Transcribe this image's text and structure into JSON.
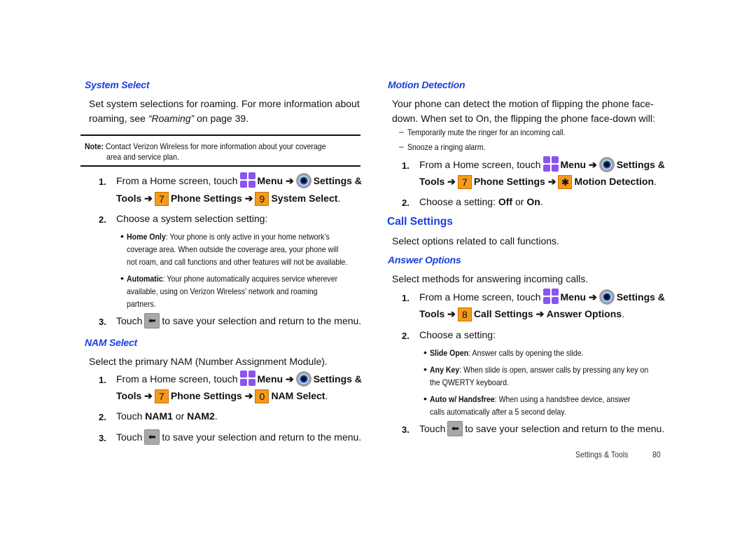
{
  "left": {
    "system_select": {
      "heading": "System Select",
      "intro_1": "Set system selections for roaming. For more information about",
      "intro_2_a": "roaming, see ",
      "intro_2_link": "“Roaming”",
      "intro_2_b": " on page 39.",
      "note_label": "Note:",
      "note_1": " Contact Verizon Wireless for more information about your coverage",
      "note_2": "area and service plan.",
      "step1_num": "1.",
      "step1_a": "From a Home screen, touch",
      "step1_menu": "Menu ➔",
      "step1_settings": "Settings &",
      "step1_tools": "Tools ➔",
      "step1_key1": "7",
      "step1_phone": "Phone Settings ➔",
      "step1_key2": "9",
      "step1_target": "System Select",
      "step1_end": ".",
      "step2_num": "2.",
      "step2": "Choose a system selection setting:",
      "opt1_label": "Home Only",
      "opt1_1": ": Your phone is only active in your home network’s",
      "opt1_2": "coverage area.  When outside the coverage area, your phone will",
      "opt1_3": "not roam, and call functions and other features will not be available.",
      "opt2_label": "Automatic",
      "opt2_1": ": Your phone automatically acquires service wherever",
      "opt2_2": "available, using on Verizon Wireless’ network and roaming",
      "opt2_3": "partners.",
      "step3_num": "3.",
      "step3_a": "Touch",
      "step3_b": "to save your selection and return to the menu."
    },
    "nam_select": {
      "heading": "NAM Select",
      "intro": "Select the primary NAM (Number Assignment Module).",
      "step1_num": "1.",
      "step1_a": "From a Home screen, touch",
      "step1_menu": "Menu ➔",
      "step1_settings": "Settings &",
      "step1_tools": "Tools ➔",
      "step1_key1": "7",
      "step1_phone": "Phone Settings ➔",
      "step1_key2": "0",
      "step1_target": "NAM Select",
      "step1_end": ".",
      "step2_num": "2.",
      "step2_a": "Touch ",
      "step2_nam1": "NAM1",
      "step2_or": " or ",
      "step2_nam2": "NAM2",
      "step2_end": ".",
      "step3_num": "3.",
      "step3_a": "Touch",
      "step3_b": "to save your selection and return to the menu."
    }
  },
  "right": {
    "motion_detection": {
      "heading": "Motion Detection",
      "intro_1": "Your phone can detect the motion of flipping the phone face-",
      "intro_2": "down.  When set to On, the flipping the phone face-down will:",
      "dash1": "Temporarily mute the ringer for an incoming call.",
      "dash2": "Snooze a ringing alarm.",
      "step1_num": "1.",
      "step1_a": "From a Home screen, touch",
      "step1_menu": "Menu ➔",
      "step1_settings": "Settings &",
      "step1_tools": "Tools ➔",
      "step1_key1": "7",
      "step1_phone": "Phone Settings ➔",
      "step1_key2": "✱",
      "step1_target": "Motion Detection",
      "step1_end": ".",
      "step2_num": "2.",
      "step2_a": "Choose a setting: ",
      "step2_off": "Off",
      "step2_or": " or ",
      "step2_on": "On",
      "step2_end": "."
    },
    "call_settings": {
      "heading": "Call Settings",
      "intro": "Select options related to call functions."
    },
    "answer_options": {
      "heading": "Answer Options",
      "intro": "Select methods for answering incoming calls.",
      "step1_num": "1.",
      "step1_a": "From a Home screen, touch",
      "step1_menu": "Menu ➔",
      "step1_settings": "Settings &",
      "step1_tools": "Tools ➔",
      "step1_key1": "8",
      "step1_target": "Call Settings ➔ Answer Options",
      "step1_end": ".",
      "step2_num": "2.",
      "step2": "Choose a setting:",
      "opt1_label": "Slide Open",
      "opt1_1": ": Answer calls by opening the slide.",
      "opt2_label": "Any Key",
      "opt2_1": ": When slide is open, answer calls by pressing any key on",
      "opt2_2": "the QWERTY keyboard.",
      "opt3_label": "Auto w/ Handsfree",
      "opt3_1": ": When using a handsfree device, answer",
      "opt3_2": "calls automatically after a 5 second delay.",
      "step3_num": "3.",
      "step3_a": "Touch",
      "step3_b": "to save your selection and return to the menu."
    }
  },
  "footer": {
    "section": "Settings & Tools",
    "page": "80"
  }
}
